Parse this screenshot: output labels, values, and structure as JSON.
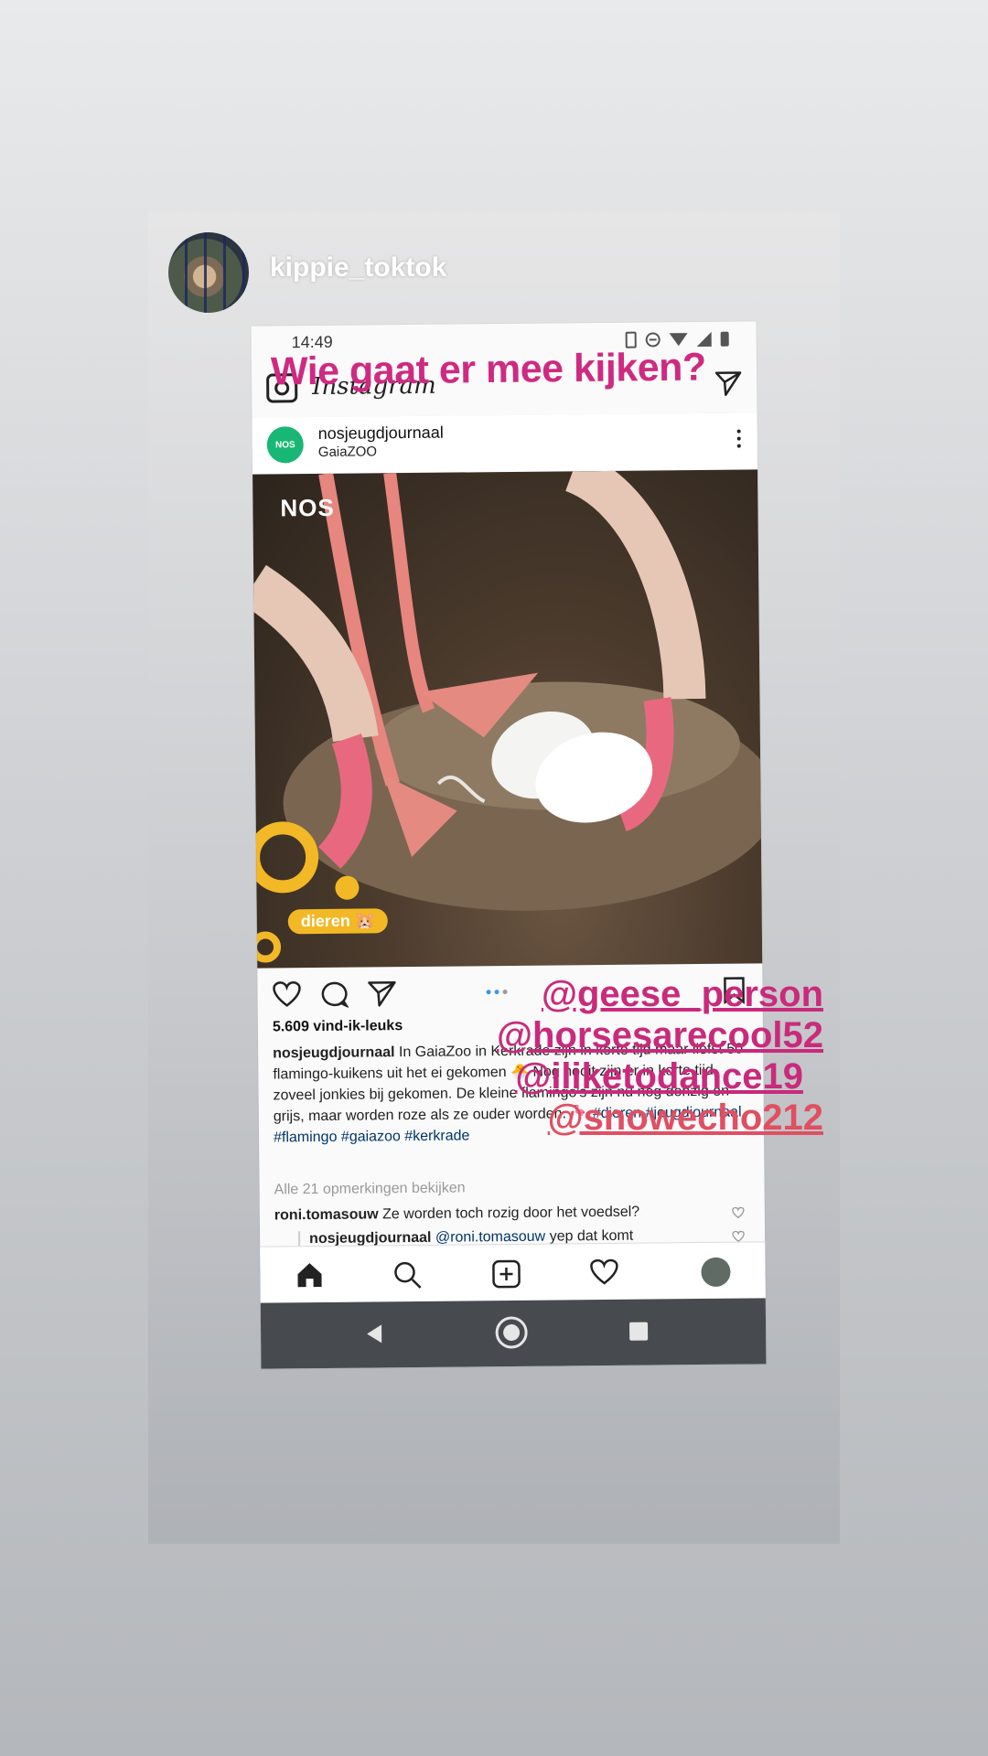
{
  "story": {
    "username": "kippie_toktok"
  },
  "screenshot": {
    "status_time": "14:49",
    "app_logo": "Instagram",
    "post": {
      "account": "nosjeugdjournaal",
      "location": "GaiaZOO",
      "avatar_text": "NOS",
      "image_watermark": "NOS",
      "image_tag": "dieren 🐹",
      "likes": "5.609 vind-ik-leuks",
      "caption_user": "nosjeugdjournaal",
      "caption_text": "In GaiaZoo in Kerkrade zijn in korte tijd maar liefst 50 flamingo-kuikens uit het ei gekomen 🐣 Nog nooit zijn er in korte tijd zoveel jonkies bij gekomen. De kleine flamingo's zijn nu nog donzig en grijs, maar worden roze als ze ouder worden. 🦩",
      "caption_tags": "#dieren #jeugdjournaal #flamingo #gaiazoo #kerkrade",
      "view_comments": "Alle 21 opmerkingen bekijken",
      "comments": [
        {
          "user": "roni.tomasouw",
          "mention": "",
          "text": "Ze worden toch rozig door het voedsel?"
        },
        {
          "user": "nosjeugdjournaal",
          "mention": "@roni.tomasouw",
          "text": "yep dat komt"
        }
      ]
    },
    "icons": {
      "heart": "heart-icon",
      "comment": "comment-icon",
      "share": "direct-share-icon",
      "save": "bookmark-icon"
    }
  },
  "overlay": {
    "question": "Wie gaat er mee kijken?",
    "question_color": "#cf2a82",
    "mentions": [
      {
        "text": "@geese_person",
        "color": "#c92a7c"
      },
      {
        "text": "@horsesarecool52",
        "color": "#c92a7c"
      },
      {
        "text": "@iliketodance19",
        "color": "#c92a7c"
      },
      {
        "text": "@snowecho212",
        "color": "#e04f62"
      }
    ]
  }
}
